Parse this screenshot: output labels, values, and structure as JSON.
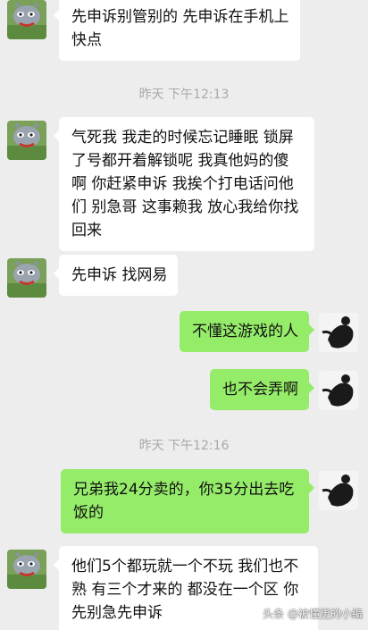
{
  "messages": [
    {
      "side": "left",
      "avatar": "tom-cat-avatar",
      "text": "先申诉别管别的 先申诉在手机上快点"
    },
    {
      "timestamp": "昨天 下午12:13"
    },
    {
      "side": "left",
      "avatar": "tom-cat-avatar",
      "text": "气死我 我走的时候忘记睡眠 锁屏了号都开着解锁呢 我真他妈的傻啊 你赶紧申诉 我挨个打电话问他们 别急哥 这事赖我 放心我给你找回来"
    },
    {
      "side": "left",
      "avatar": "tom-cat-avatar",
      "text": "先申诉 找网易"
    },
    {
      "side": "right",
      "avatar": "dark-figure-avatar",
      "text": "不懂这游戏的人"
    },
    {
      "side": "right",
      "avatar": "dark-figure-avatar",
      "text": "也不会弄啊"
    },
    {
      "timestamp": "昨天 下午12:16"
    },
    {
      "side": "right",
      "avatar": "dark-figure-avatar",
      "text": "兄弟我24分卖的，你35分出去吃饭的"
    },
    {
      "side": "left",
      "avatar": "tom-cat-avatar",
      "text": "他们5个都玩就一个不玩 我们也不熟 有三个才来的 都没在一个区 你先别急先申诉"
    }
  ],
  "watermark": "头条 @被懂更的小編",
  "colors": {
    "background": "#ededed",
    "bubble_left": "#ffffff",
    "bubble_right": "#95ec69",
    "timestamp": "#a9a9a9"
  }
}
